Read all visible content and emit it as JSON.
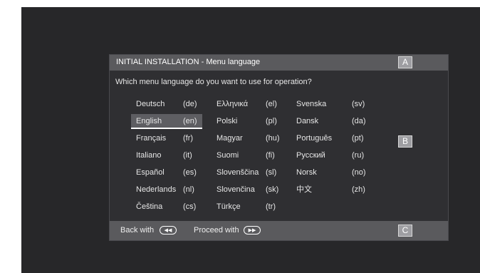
{
  "dialog": {
    "title": "INITIAL INSTALLATION - Menu language",
    "question": "Which menu language do you want to use for operation?",
    "badges": {
      "a": "A",
      "b": "B",
      "c": "C"
    }
  },
  "languages": [
    {
      "name": "Deutsch",
      "code": "(de)"
    },
    {
      "name": "English",
      "code": "(en)",
      "selected": true
    },
    {
      "name": "Français",
      "code": "(fr)"
    },
    {
      "name": "Italiano",
      "code": "(it)"
    },
    {
      "name": "Español",
      "code": "(es)"
    },
    {
      "name": "Nederlands",
      "code": "(nl)"
    },
    {
      "name": "Čeština",
      "code": "(cs)"
    },
    {
      "name": "Ελληνικά",
      "code": "(el)"
    },
    {
      "name": "Polski",
      "code": "(pl)"
    },
    {
      "name": "Magyar",
      "code": "(hu)"
    },
    {
      "name": "Suomi",
      "code": "(fi)"
    },
    {
      "name": "Slovenščina",
      "code": "(sl)"
    },
    {
      "name": "Slovenčina",
      "code": "(sk)"
    },
    {
      "name": "Türkçe",
      "code": "(tr)"
    },
    {
      "name": "Svenska",
      "code": "(sv)"
    },
    {
      "name": "Dansk",
      "code": "(da)"
    },
    {
      "name": "Português",
      "code": "(pt)"
    },
    {
      "name": "Русский",
      "code": "(ru)"
    },
    {
      "name": "Norsk",
      "code": "(no)"
    },
    {
      "name": "中文",
      "code": "(zh)"
    }
  ],
  "footer": {
    "back_label": "Back with",
    "back_icon": "rewind-button-icon",
    "back_glyph": "◀◀",
    "proceed_label": "Proceed with",
    "proceed_icon": "fast-forward-button-icon",
    "proceed_glyph": "▶▶"
  }
}
